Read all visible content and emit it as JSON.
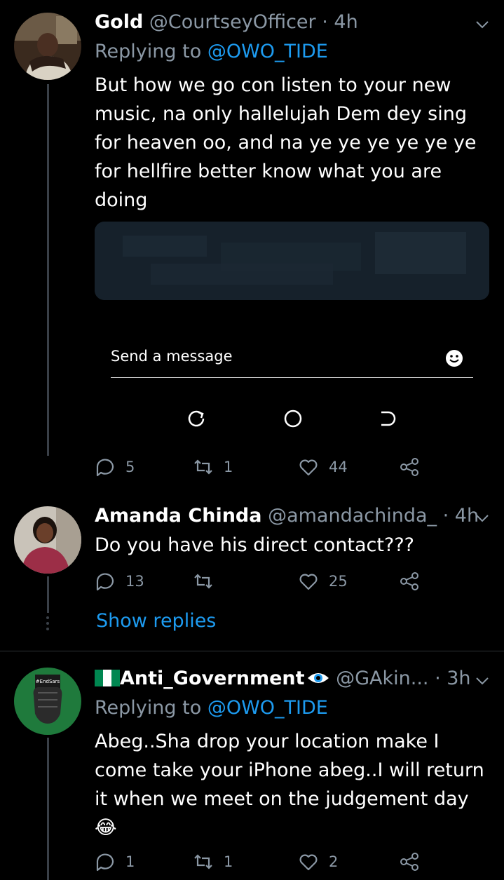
{
  "tweets": [
    {
      "name": "Gold",
      "handle": "@CourtseyOfficer",
      "time": "· 4h",
      "replying_prefix": "Replying to",
      "replying_to": "@OWO_TIDE",
      "text": "But how we go con listen to your new music, na only hallelujah Dem dey sing for heaven oo, and na ye ye ye ye ye ye for hellfire better know what you are doing",
      "replies": "5",
      "retweets": "1",
      "likes": "44"
    },
    {
      "name": "Amanda Chinda",
      "handle": "@amandachinda_",
      "time": "· 4h",
      "text": "Do you have his direct contact???",
      "replies": "13",
      "retweets": "",
      "likes": "25",
      "show_replies": "Show replies"
    },
    {
      "name": "Anti_Government",
      "handle": "@GAkin...",
      "time": "· 3h",
      "replying_prefix": "Replying to",
      "replying_to": "@OWO_TIDE",
      "text": "Abeg..Sha drop your location make I come take your iPhone abeg..I will return it when we meet on the judgement day",
      "emoji": "😂",
      "replies": "1",
      "retweets": "1",
      "likes": "2",
      "avatar_text_1": "#EndSars"
    }
  ],
  "composer": {
    "placeholder": "Send a message"
  },
  "icons": {
    "caret": "chevron-down-icon",
    "reply": "reply-icon",
    "retweet": "retweet-icon",
    "like": "heart-icon",
    "share": "share-icon",
    "emoji": "emoji-icon",
    "flag": "nigeria-flag-icon",
    "eye": "eye-icon"
  },
  "colors": {
    "background": "#000000",
    "link": "#1d9bf0",
    "muted": "#8b98a5",
    "divider": "#2f3336"
  }
}
